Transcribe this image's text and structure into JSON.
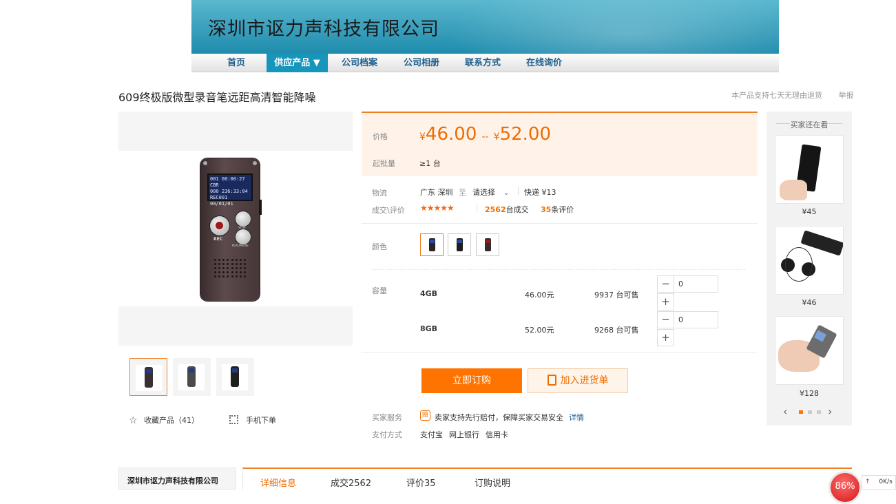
{
  "header": {
    "company_name": "深圳市讴力声科技有限公司",
    "nav": [
      {
        "label": "首页"
      },
      {
        "label": "供应产品 ▼"
      },
      {
        "label": "公司档案"
      },
      {
        "label": "公司相册"
      },
      {
        "label": "联系方式"
      },
      {
        "label": "在线询价"
      }
    ]
  },
  "product": {
    "title": "609终极版微型录音笔远距高清智能降噪",
    "notes": [
      "本产品支持七天无理由退货",
      "举报"
    ],
    "recorder_screen": [
      "001  00:00:27  CBR",
      "000  236:33:04",
      "REC001 00/01/01"
    ],
    "recorder_labels": {
      "rec": "REC",
      "stop": "STOP",
      "play": "PLAY/PAUSE"
    },
    "favorite": "收藏产品（41）",
    "mobile_order": "手机下单"
  },
  "pricing": {
    "price_label": "价格",
    "currency": "¥",
    "price_low": "46.00",
    "separator": "--",
    "price_high": "52.00",
    "moq_label": "起批量",
    "moq_value": "≥1 台"
  },
  "logistics": {
    "label": "物流",
    "origin": "广东 深圳",
    "to": "至",
    "destination": "请选择",
    "shipping": "快递 ¥13"
  },
  "deals": {
    "label": "成交\\评价",
    "stars": "★★★★★",
    "rating": 4.5,
    "deal_count": "2562",
    "deal_text": "台成交",
    "review_count": "35",
    "review_text": "条评价"
  },
  "color": {
    "label": "颜色",
    "options": 3,
    "selected": 1
  },
  "capacity": {
    "label": "容量",
    "rows": [
      {
        "name": "4GB",
        "price": "46.00元",
        "stock": "9937 台可售",
        "qty": "0"
      },
      {
        "name": "8GB",
        "price": "52.00元",
        "stock": "9268 台可售",
        "qty": "0"
      }
    ]
  },
  "actions": {
    "buy_now": "立即订购",
    "add_cart": "加入进货单"
  },
  "service": {
    "label": "买家服务",
    "badge": "赔",
    "text": "卖家支持先行赔付，保障买家交易安全",
    "detail_link": "详情",
    "payment_label": "支付方式",
    "payments": [
      "支付宝",
      "网上银行",
      "信用卡"
    ]
  },
  "side": {
    "title": "买家还在看",
    "items": [
      {
        "price": "¥45"
      },
      {
        "price": "¥46"
      },
      {
        "price": "¥128"
      }
    ]
  },
  "bottom": {
    "company_name": "深圳市讴力声科技有限公司",
    "tabs": [
      "详细信息",
      "成交2562",
      "评价35",
      "订购说明"
    ]
  },
  "overlay": {
    "percent": "86%",
    "speed": "0K/s"
  },
  "colors": {
    "accent": "#ff7300",
    "nav_active": "#1895bb",
    "banner": "#3fa3bf"
  }
}
